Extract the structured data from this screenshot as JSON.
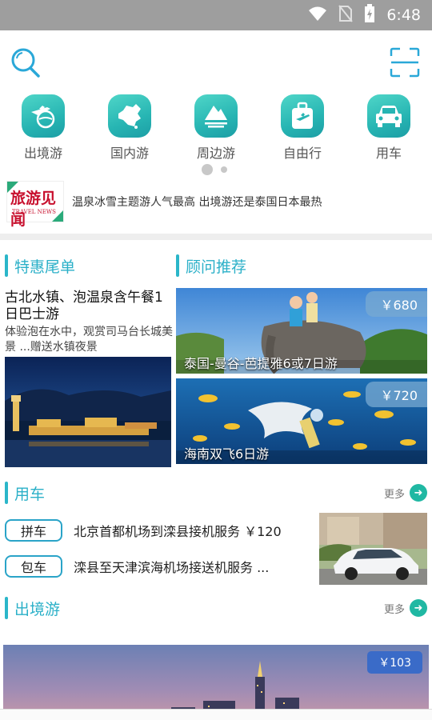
{
  "status_bar": {
    "time": "6:48",
    "icons": [
      "wifi-icon",
      "no-sim-icon",
      "battery-charging-icon"
    ]
  },
  "top_bar": {
    "icons": [
      "search-icon",
      "scan-icon"
    ]
  },
  "categories": [
    {
      "label": "出境游",
      "icon": "plane-globe-icon"
    },
    {
      "label": "国内游",
      "icon": "china-map-icon"
    },
    {
      "label": "周边游",
      "icon": "mountain-icon"
    },
    {
      "label": "自由行",
      "icon": "luggage-icon"
    },
    {
      "label": "用车",
      "icon": "car-icon"
    }
  ],
  "carousel": {
    "pages": 2,
    "active": 1
  },
  "news": {
    "logo_text": "旅游见闻",
    "logo_sub": "TRAVEL NEWS",
    "headline": "温泉冰雪主题游人气最高 出境游还是泰国日本最热"
  },
  "specials": {
    "section_title": "特惠尾单",
    "title": "古北水镇、泡温泉含午餐1日巴士游",
    "desc": "体验泡在水中，观赏司马台长城美景 ...赠送水镇夜景"
  },
  "recommend": {
    "section_title": "顾问推荐",
    "items": [
      {
        "caption": "泰国-曼谷-芭提雅6或7日游",
        "price": "￥680"
      },
      {
        "caption": "海南双飞6日游",
        "price": "￥720"
      }
    ]
  },
  "car": {
    "section_title": "用车",
    "more": "更多",
    "rows": [
      {
        "tag": "拼车",
        "text": "北京首都机场到滦县接机服务  ￥120"
      },
      {
        "tag": "包车",
        "text": "滦县至天津滨海机场接送机服务  ..."
      }
    ]
  },
  "abroad": {
    "section_title": "出境游",
    "more": "更多",
    "price": "￥103"
  },
  "colors": {
    "accent": "#2bb6c9",
    "status_bar": "#9e9e9e",
    "icon_bg": "#27b5b3"
  }
}
